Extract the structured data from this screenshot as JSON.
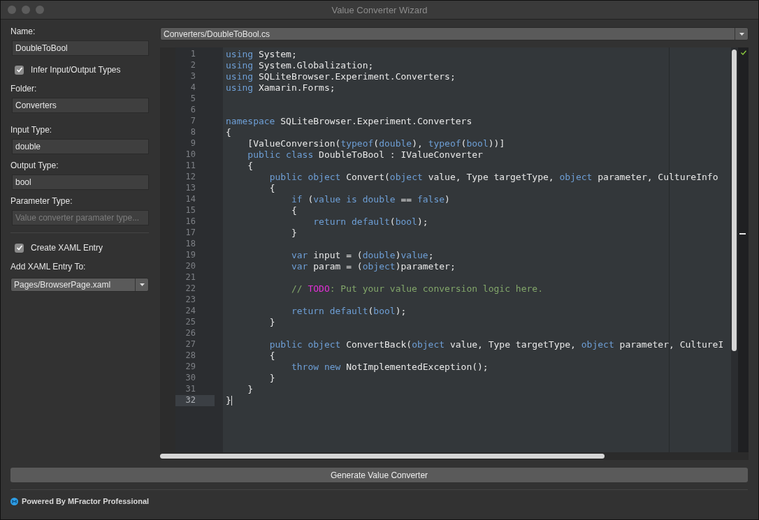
{
  "window": {
    "title": "Value Converter Wizard"
  },
  "form": {
    "name": {
      "label": "Name:",
      "value": "DoubleToBool"
    },
    "infer_types": {
      "label": "Infer Input/Output Types",
      "checked": true
    },
    "folder": {
      "label": "Folder:",
      "value": "Converters"
    },
    "input_type": {
      "label": "Input Type:",
      "value": "double"
    },
    "output_type": {
      "label": "Output Type:",
      "value": "bool"
    },
    "parameter_type": {
      "label": "Parameter Type:",
      "placeholder": "Value converter paramater type..."
    },
    "create_xaml": {
      "label": "Create XAML Entry",
      "checked": true
    },
    "xaml_target": {
      "label": "Add XAML Entry To:",
      "value": "Pages/BrowserPage.xaml"
    }
  },
  "file_selector": {
    "value": "Converters/DoubleToBool.cs"
  },
  "editor": {
    "lines": [
      {
        "number": "1",
        "current": false,
        "tokens": [
          {
            "kw": "using"
          },
          {
            "tx": " System;"
          }
        ]
      },
      {
        "number": "2",
        "current": false,
        "tokens": [
          {
            "kw": "using"
          },
          {
            "tx": " System.Globalization;"
          }
        ]
      },
      {
        "number": "3",
        "current": false,
        "tokens": [
          {
            "kw": "using"
          },
          {
            "tx": " SQLiteBrowser.Experiment.Converters;"
          }
        ]
      },
      {
        "number": "4",
        "current": false,
        "tokens": [
          {
            "kw": "using"
          },
          {
            "tx": " Xamarin.Forms;"
          }
        ]
      },
      {
        "number": "5",
        "current": false
      },
      {
        "number": "6",
        "current": false
      },
      {
        "number": "7",
        "current": false,
        "tokens": [
          {
            "kw": "namespace"
          },
          {
            "tx": " SQLiteBrowser.Experiment.Converters"
          }
        ]
      },
      {
        "number": "8",
        "current": false,
        "tokens": [
          {
            "tx": "{"
          }
        ]
      },
      {
        "number": "9",
        "current": false,
        "tokens": [
          {
            "tx": "    [ValueConversion("
          },
          {
            "kw": "typeof"
          },
          {
            "tx": "("
          },
          {
            "kw": "double"
          },
          {
            "tx": "), "
          },
          {
            "kw": "typeof"
          },
          {
            "tx": "("
          },
          {
            "kw": "bool"
          },
          {
            "tx": "))]"
          }
        ]
      },
      {
        "number": "10",
        "current": false,
        "tokens": [
          {
            "kw": "    public class"
          },
          {
            "tx": " DoubleToBool : IValueConverter"
          }
        ]
      },
      {
        "number": "11",
        "current": false,
        "tokens": [
          {
            "tx": "    {"
          }
        ]
      },
      {
        "number": "12",
        "current": false,
        "tokens": [
          {
            "kw": "        public object"
          },
          {
            "tx": " Convert("
          },
          {
            "kw": "object"
          },
          {
            "tx": " value, Type targetType, "
          },
          {
            "kw": "object"
          },
          {
            "tx": " parameter, CultureInfo"
          }
        ]
      },
      {
        "number": "13",
        "current": false,
        "tokens": [
          {
            "tx": "        {"
          }
        ]
      },
      {
        "number": "14",
        "current": false,
        "tokens": [
          {
            "kw": "            if"
          },
          {
            "tx": " ("
          },
          {
            "kw": "value is double"
          },
          {
            "tx": " == "
          },
          {
            "kw": "false"
          },
          {
            "tx": ")"
          }
        ]
      },
      {
        "number": "15",
        "current": false,
        "tokens": [
          {
            "tx": "            {"
          }
        ]
      },
      {
        "number": "16",
        "current": false,
        "tokens": [
          {
            "kw": "                return default"
          },
          {
            "tx": "("
          },
          {
            "kw": "bool"
          },
          {
            "tx": ");"
          }
        ]
      },
      {
        "number": "17",
        "current": false,
        "tokens": [
          {
            "tx": "            }"
          }
        ]
      },
      {
        "number": "18",
        "current": false
      },
      {
        "number": "19",
        "current": false,
        "tokens": [
          {
            "kw": "            var"
          },
          {
            "tx": " input = ("
          },
          {
            "kw": "double"
          },
          {
            "tx": ")"
          },
          {
            "kw": "value"
          },
          {
            "tx": ";"
          }
        ]
      },
      {
        "number": "20",
        "current": false,
        "tokens": [
          {
            "kw": "            var"
          },
          {
            "tx": " param = ("
          },
          {
            "kw": "object"
          },
          {
            "tx": ")parameter;"
          }
        ]
      },
      {
        "number": "21",
        "current": false
      },
      {
        "number": "22",
        "current": false,
        "tokens": [
          {
            "cm": "            // "
          },
          {
            "todo": "TODO"
          },
          {
            "cm": ": Put your value conversion logic here."
          }
        ]
      },
      {
        "number": "23",
        "current": false
      },
      {
        "number": "24",
        "current": false,
        "tokens": [
          {
            "kw": "            return default"
          },
          {
            "tx": "("
          },
          {
            "kw": "bool"
          },
          {
            "tx": ");"
          }
        ]
      },
      {
        "number": "25",
        "current": false,
        "tokens": [
          {
            "tx": "        }"
          }
        ]
      },
      {
        "number": "26",
        "current": false
      },
      {
        "number": "27",
        "current": false,
        "tokens": [
          {
            "kw": "        public object"
          },
          {
            "tx": " ConvertBack("
          },
          {
            "kw": "object"
          },
          {
            "tx": " value, Type targetType, "
          },
          {
            "kw": "object"
          },
          {
            "tx": " parameter, CultureI"
          }
        ]
      },
      {
        "number": "28",
        "current": false,
        "tokens": [
          {
            "tx": "        {"
          }
        ]
      },
      {
        "number": "29",
        "current": false,
        "tokens": [
          {
            "kw": "            throw new"
          },
          {
            "tx": " NotImplementedException();"
          }
        ]
      },
      {
        "number": "30",
        "current": false,
        "tokens": [
          {
            "tx": "        }"
          }
        ]
      },
      {
        "number": "31",
        "current": false,
        "tokens": [
          {
            "tx": "    }"
          }
        ]
      },
      {
        "number": "32",
        "current": true,
        "tokens": [
          {
            "tx": "}"
          }
        ]
      }
    ]
  },
  "generate_button": {
    "label": "Generate Value Converter"
  },
  "footer": {
    "text": "Powered By MFractor Professional"
  }
}
